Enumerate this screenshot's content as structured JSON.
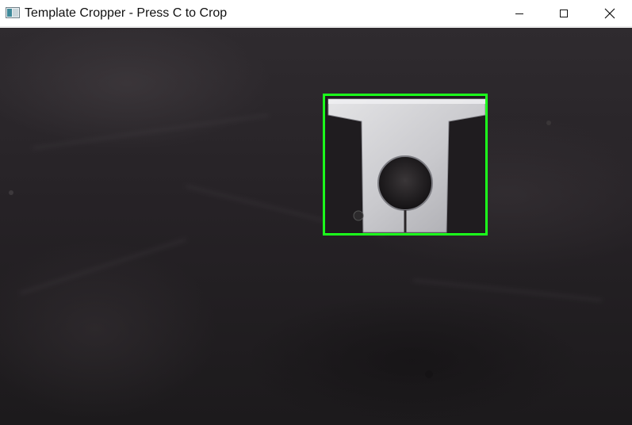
{
  "window": {
    "title": "Template Cropper - Press C to Crop",
    "app_icon": "opencv-window-icon",
    "controls": {
      "minimize_icon": "minimize-icon",
      "maximize_icon": "maximize-icon",
      "close_icon": "close-icon"
    }
  },
  "image_view": {
    "subject": "aluminum-shaft-support-bracket",
    "selection_color": "#1cff1c",
    "background_color": "#262226"
  }
}
